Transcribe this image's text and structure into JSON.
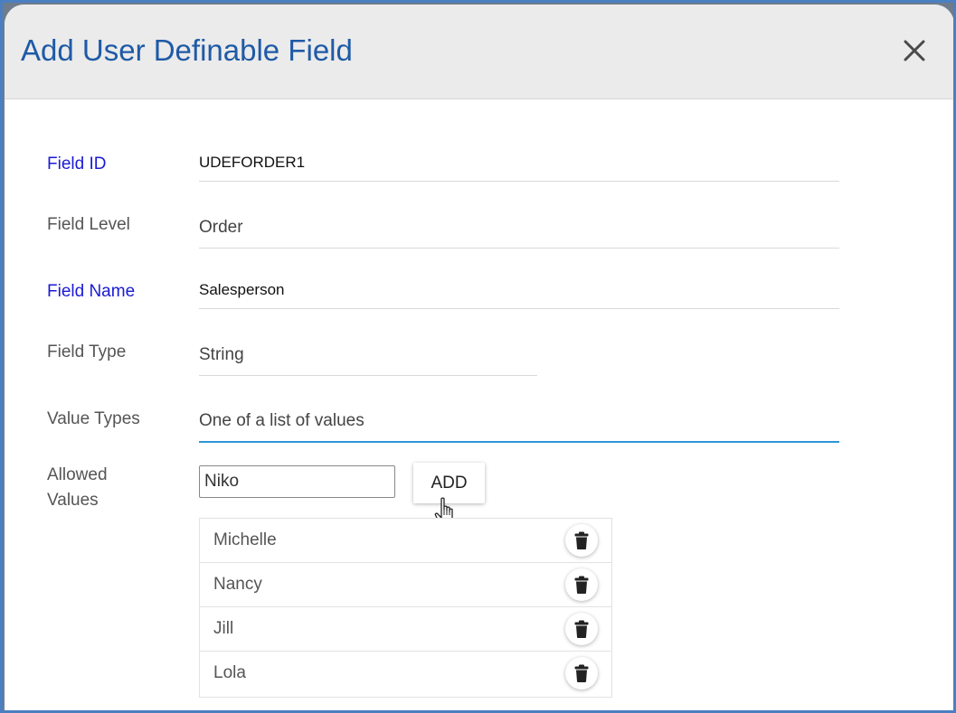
{
  "dialog": {
    "title": "Add User Definable Field",
    "close_icon": "close-icon"
  },
  "form": {
    "field_id": {
      "label": "Field ID",
      "value": "UDEFORDER1"
    },
    "field_level": {
      "label": "Field Level",
      "value": "Order"
    },
    "field_name": {
      "label": "Field Name",
      "value": "Salesperson"
    },
    "field_type": {
      "label": "Field Type",
      "value": "String"
    },
    "value_types": {
      "label": "Value Types",
      "value": "One of a list of values"
    },
    "allowed_values": {
      "label": "Allowed Values",
      "input_value": "Niko",
      "add_label": "ADD",
      "items": [
        {
          "name": "Michelle"
        },
        {
          "name": "Nancy"
        },
        {
          "name": "Jill"
        },
        {
          "name": "Lola"
        }
      ]
    }
  },
  "colors": {
    "title": "#1f5aa6",
    "required_label": "#1a1ad4",
    "focus_underline": "#2f95d8",
    "frame_border": "#4a7fc1"
  },
  "icons": {
    "delete": "trash-icon",
    "pointer": "hand-pointer-icon"
  }
}
